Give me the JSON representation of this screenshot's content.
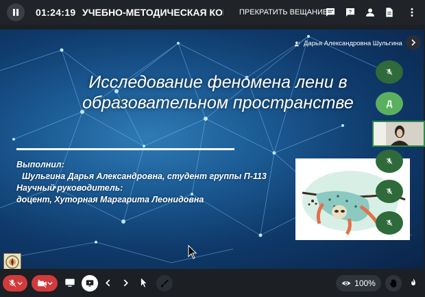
{
  "header": {
    "timer": "01:24:19",
    "conference_title": "УЧЕБНО-МЕТОДИЧЕСКАЯ КОНФ",
    "stop_broadcast_label": "ПРЕКРАТИТЬ ВЕЩАНИЕ",
    "icons": [
      "chat-icon",
      "help-icon",
      "user-icon",
      "document-icon",
      "more-vert-icon"
    ]
  },
  "presenter": {
    "name": "Дарья Александровна Шульгина"
  },
  "participants": [
    {
      "type": "muted",
      "icon": "mic-off-icon"
    },
    {
      "type": "letter",
      "letter": "Д"
    },
    {
      "type": "video"
    },
    {
      "type": "muted",
      "icon": "mic-off-icon"
    },
    {
      "type": "muted",
      "icon": "mic-off-icon"
    },
    {
      "type": "muted",
      "icon": "mic-off-icon"
    }
  ],
  "slide": {
    "title_line1": "Исследование феномена лени в",
    "title_line2": "образовательном пространстве",
    "performed_label": "Выполнил:",
    "student": "Шульгина Дарья Александровна, студент группы П-113",
    "advisor_label": "Научный руководитель:",
    "advisor": "доцент, Хуторная Маргарита Леонидовна"
  },
  "toolbar": {
    "zoom": "100%"
  },
  "colors": {
    "topbar_bg": "#202327",
    "mute_red": "#d13b3b",
    "participant_green": "#2e6a3a",
    "letter_avatar_green": "#5bb05f"
  }
}
